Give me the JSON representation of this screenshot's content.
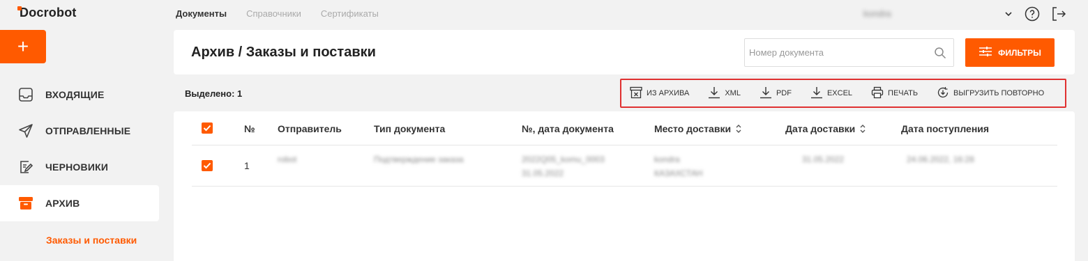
{
  "app": {
    "logo": "Docrobot"
  },
  "sidebar": {
    "add_label": "+",
    "items": [
      {
        "label": "ВХОДЯЩИЕ",
        "icon": "inbox-icon"
      },
      {
        "label": "ОТПРАВЛЕННЫЕ",
        "icon": "send-icon"
      },
      {
        "label": "ЧЕРНОВИКИ",
        "icon": "draft-icon"
      },
      {
        "label": "АРХИВ",
        "icon": "archive-icon"
      }
    ],
    "sub_item": "Заказы и поставки"
  },
  "topnav": {
    "tabs": [
      "Документы",
      "Справочники",
      "Сертификаты"
    ],
    "user": "kondra"
  },
  "header": {
    "title": "Архив / Заказы и поставки",
    "search_placeholder": "Номер документа",
    "filter_label": "ФИЛЬТРЫ"
  },
  "toolbar": {
    "selected": "Выделено: 1",
    "buttons": [
      "ИЗ АРХИВА",
      "XML",
      "PDF",
      "EXCEL",
      "ПЕЧАТЬ",
      "ВЫГРУЗИТЬ ПОВТОРНО"
    ]
  },
  "table": {
    "columns": [
      "№",
      "Отправитель",
      "Тип документа",
      "№, дата документа",
      "Место доставки",
      "Дата доставки",
      "Дата поступления"
    ],
    "rows": [
      {
        "num": "1",
        "sender": "robot",
        "doc_type": "Подтверждение заказа",
        "doc_num": "2022Q05_komu_0003",
        "doc_date": "31.05.2022",
        "place_1": "kondra",
        "place_2": "КАЗАХСТАН",
        "delivery_date": "31.05.2022",
        "received": "24.06.2022, 16:28"
      }
    ]
  },
  "colors": {
    "accent": "#ff5a00",
    "highlight": "#e03030"
  }
}
